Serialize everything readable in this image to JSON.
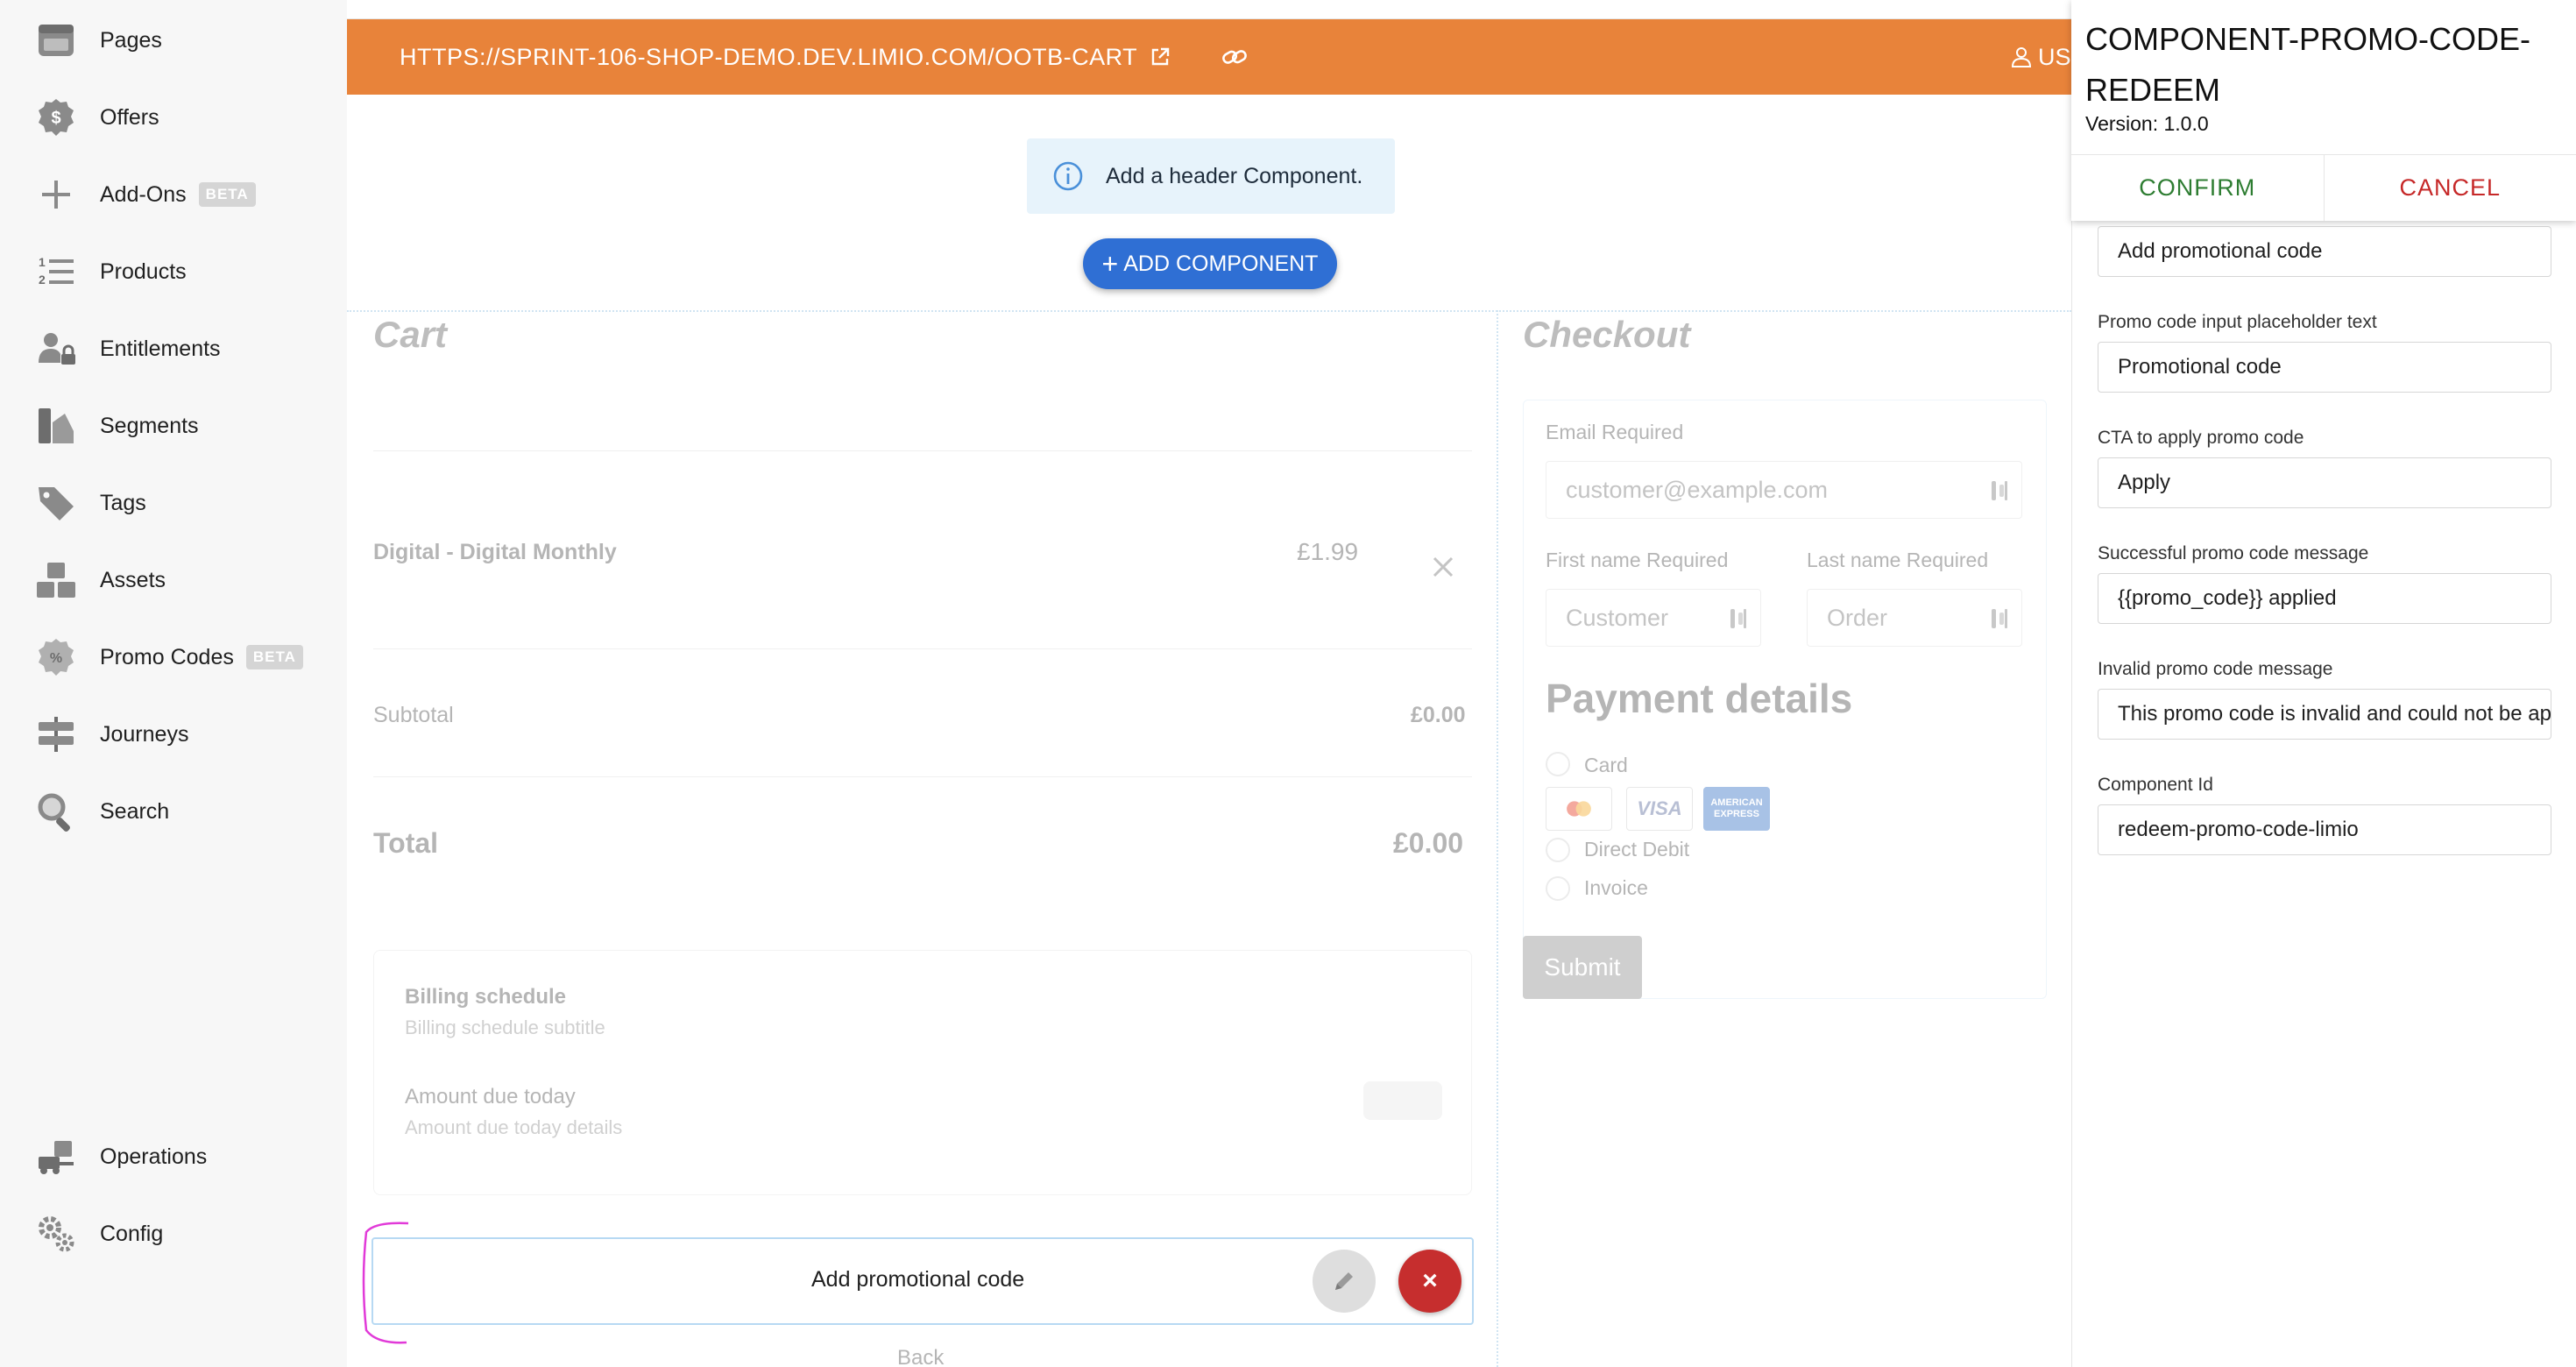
{
  "sidebar": {
    "items": [
      {
        "label": "Pages",
        "icon": "pages-icon"
      },
      {
        "label": "Offers",
        "icon": "offers-dollar-icon"
      },
      {
        "label": "Add-Ons",
        "icon": "plus-icon",
        "badge": "BETA"
      },
      {
        "label": "Products",
        "icon": "numbered-list-icon"
      },
      {
        "label": "Entitlements",
        "icon": "user-lock-icon"
      },
      {
        "label": "Segments",
        "icon": "segments-icon"
      },
      {
        "label": "Tags",
        "icon": "tags-icon"
      },
      {
        "label": "Assets",
        "icon": "boxes-icon"
      },
      {
        "label": "Promo Codes",
        "icon": "percent-badge-icon",
        "badge": "BETA"
      },
      {
        "label": "Journeys",
        "icon": "signpost-icon"
      },
      {
        "label": "Search",
        "icon": "magnifier-icon"
      }
    ],
    "bottom_items": [
      {
        "label": "Operations",
        "icon": "forklift-icon"
      },
      {
        "label": "Config",
        "icon": "gears-icon"
      }
    ]
  },
  "urlbar": {
    "url": "HTTPS://SPRINT-106-SHOP-DEMO.DEV.LIMIO.COM/OOTB-CART",
    "user": "US",
    "color": "#e8833a"
  },
  "canvas": {
    "header_alert": "Add a header Component.",
    "add_component": "ADD COMPONENT"
  },
  "cart": {
    "title": "Cart",
    "item_name": "Digital - Digital Monthly",
    "item_price": "£1.99",
    "subtotal_label": "Subtotal",
    "subtotal_value": "£0.00",
    "total_label": "Total",
    "total_value": "£0.00",
    "billing_title": "Billing schedule",
    "billing_subtitle": "Billing schedule subtitle",
    "amount_title": "Amount due today",
    "amount_subtitle": "Amount due today details",
    "promo_component_text": "Add promotional code",
    "back": "Back"
  },
  "checkout": {
    "title": "Checkout",
    "email_label": "Email Required",
    "email_placeholder": "customer@example.com",
    "first_name_label": "First name Required",
    "first_name_placeholder": "Customer",
    "last_name_label": "Last name Required",
    "last_name_placeholder": "Order",
    "payment_title": "Payment details",
    "payment_options": [
      "Card",
      "Direct Debit",
      "Invoice"
    ],
    "card_logos": {
      "visa": "VISA",
      "amex_top": "AMERICAN",
      "amex_bottom": "EXPRESS"
    },
    "submit": "Submit"
  },
  "panel": {
    "title": "COMPONENT-PROMO-CODE-REDEEM",
    "version": "Version: 1.0.0",
    "confirm": "CONFIRM",
    "cancel": "CANCEL",
    "fields": [
      {
        "label": "",
        "value": "Add promotional code"
      },
      {
        "label": "Promo code input placeholder text",
        "value": "Promotional code"
      },
      {
        "label": "CTA to apply promo code",
        "value": "Apply"
      },
      {
        "label": "Successful promo code message",
        "value": "{{promo_code}} applied"
      },
      {
        "label": "Invalid promo code message",
        "value": "This promo code is invalid and could not be applied"
      },
      {
        "label": "Component Id",
        "value": "redeem-promo-code-limio"
      }
    ]
  }
}
